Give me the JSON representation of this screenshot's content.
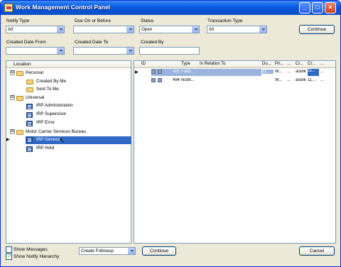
{
  "window": {
    "title": "Work Management Control Panel"
  },
  "filters": {
    "notify_type": {
      "label": "Notify Type",
      "value": "All"
    },
    "due_on": {
      "label": "Due On or Before",
      "value": ""
    },
    "status": {
      "label": "Status",
      "value": "Open"
    },
    "transaction_type": {
      "label": "Transaction Type",
      "value": "All"
    },
    "created_from": {
      "label": "Created Date From",
      "value": ""
    },
    "created_to": {
      "label": "Created Date To",
      "value": ""
    },
    "created_by": {
      "label": "Created By",
      "value": ""
    },
    "continue_label": "Continue"
  },
  "tree": {
    "header": "Location",
    "nodes": [
      {
        "label": "Personal",
        "expander": "⊟"
      },
      {
        "label": "Created By Me"
      },
      {
        "label": "Sent To Me"
      },
      {
        "label": "Universal",
        "expander": "⊟"
      },
      {
        "label": "IRP Administration"
      },
      {
        "label": "IRP Supervisor"
      },
      {
        "label": "IRP Error"
      },
      {
        "label": "Motor Carrier Services Bureau",
        "expander": "⊟"
      },
      {
        "label": "IRP General"
      },
      {
        "label": "IRP Hold"
      }
    ]
  },
  "grid": {
    "columns": [
      "ID",
      "Type",
      "In Relation To",
      "Du...",
      "Pri...",
      "...",
      "Cr...",
      "Cr...",
      "..."
    ],
    "rows": [
      {
        "id": "495",
        "type": "Follo...",
        "rel": "",
        "due": "11...",
        "pri": "W...",
        "c1": "...",
        "cr1": "arank",
        "cr2": "11...",
        "c2": "..."
      },
      {
        "id": "494",
        "type": "Notifi...",
        "rel": "",
        "due": "",
        "pri": "W...",
        "c1": "...",
        "cr1": "arank",
        "cr2": "11...",
        "c2": "..."
      }
    ]
  },
  "bottom": {
    "show_messages": "Show Messages",
    "show_notify": "Show Notify Hierarchy",
    "action_value": "Create Followup",
    "continue_label": "Continue",
    "cancel_label": "Cancel"
  }
}
